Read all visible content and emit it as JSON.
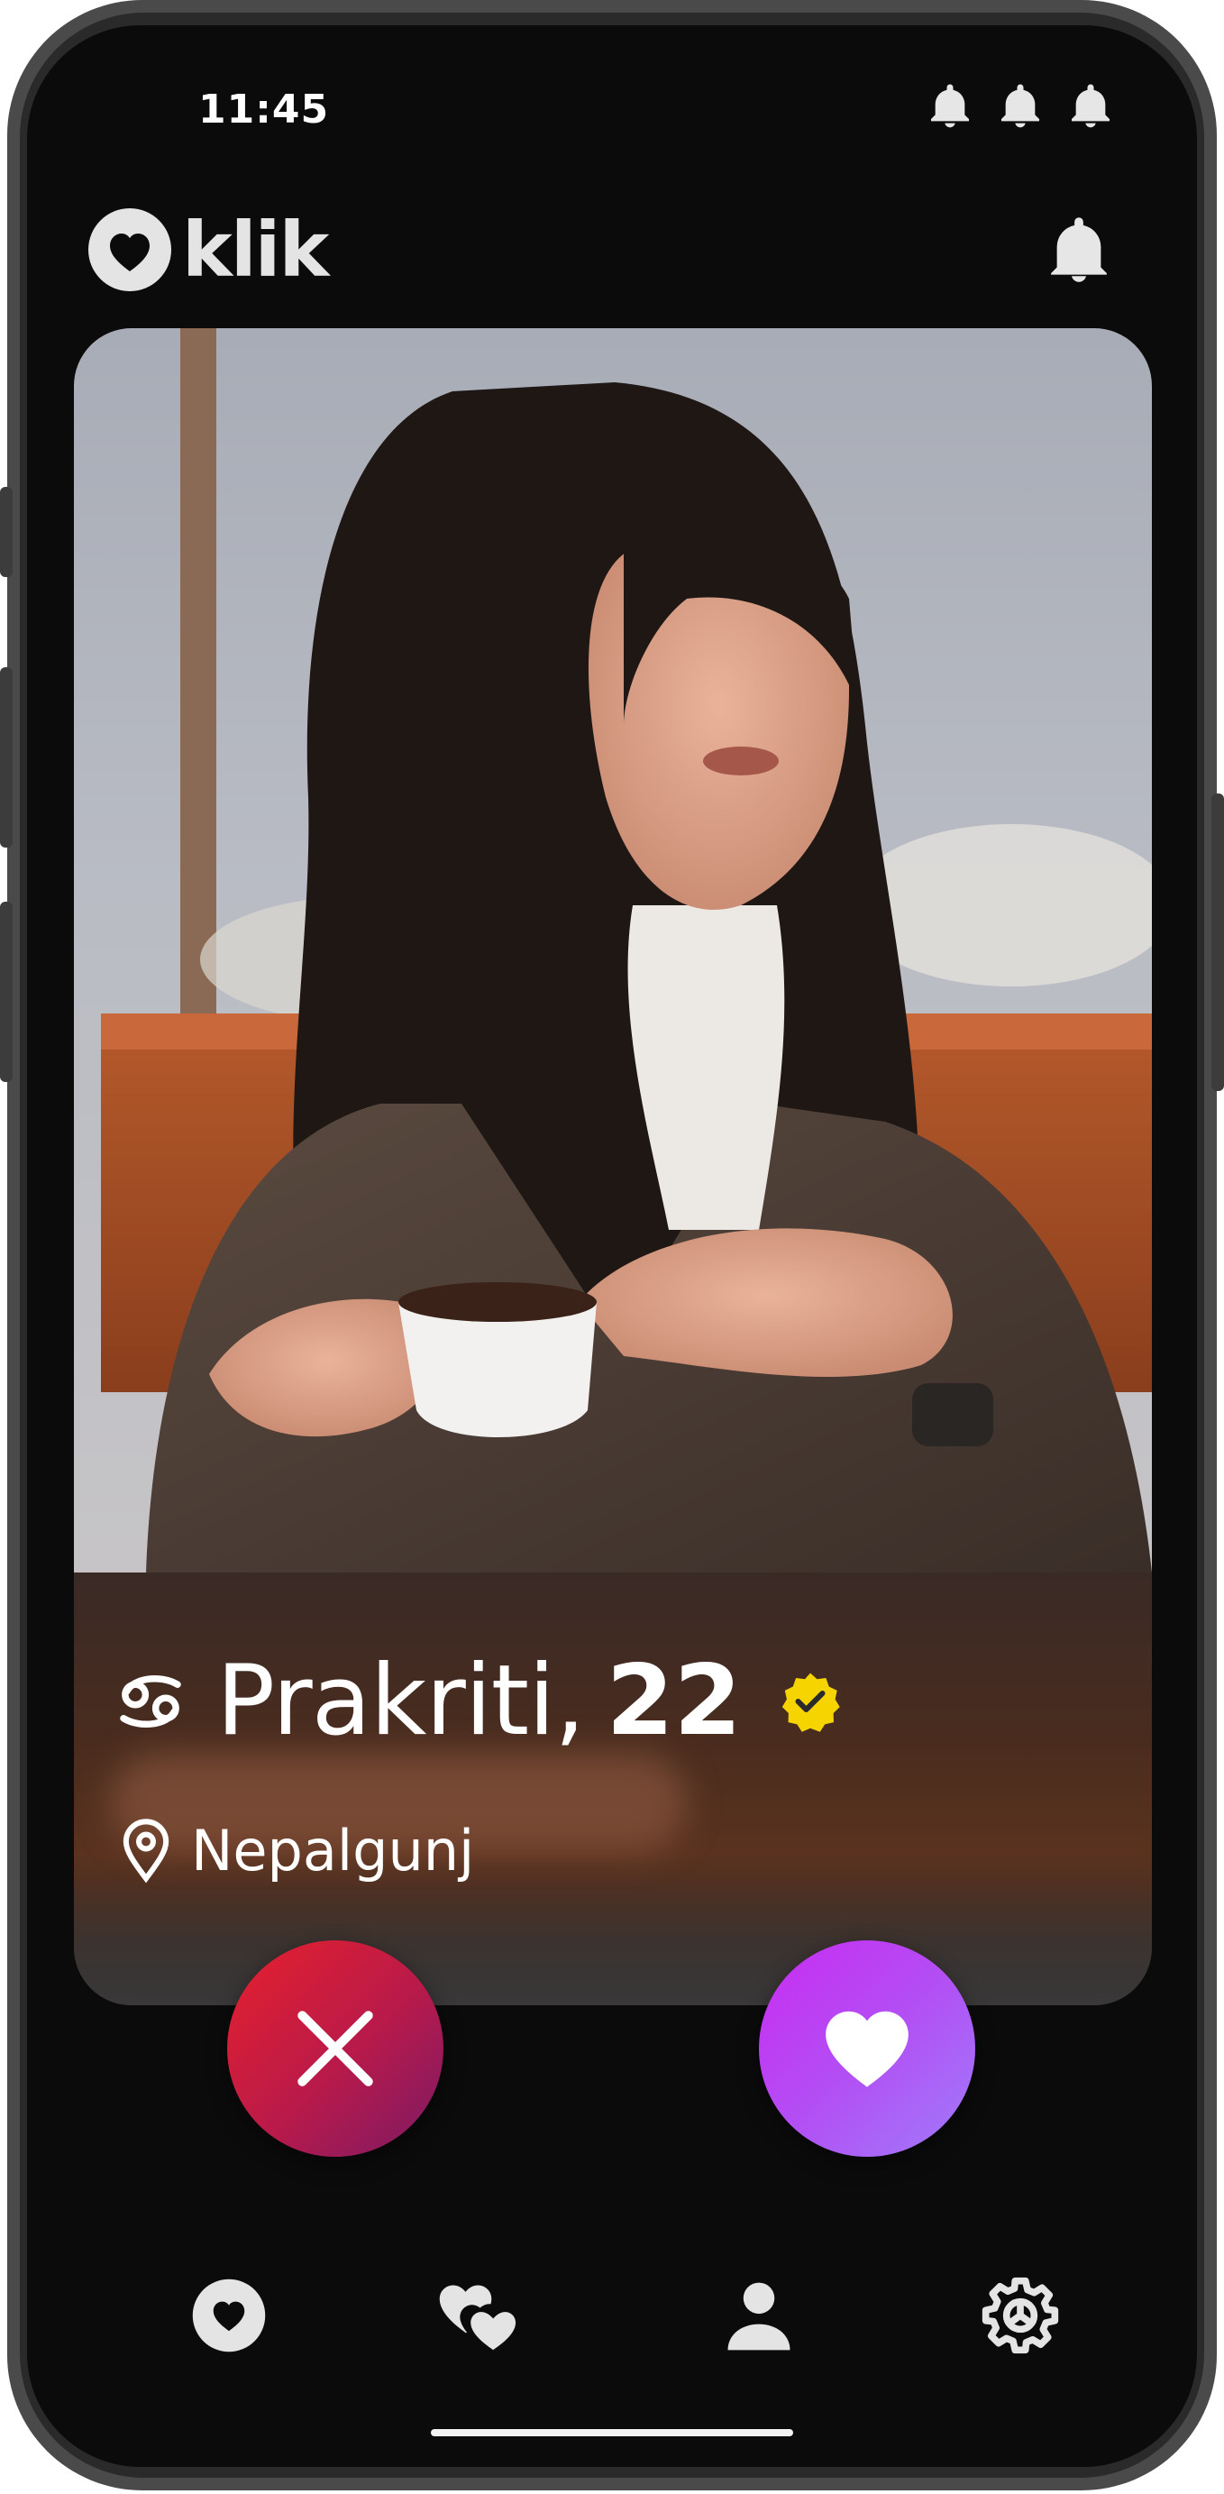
{
  "status_bar": {
    "time": "11:45",
    "icons": [
      "bell-icon",
      "bell-icon",
      "bell-icon"
    ]
  },
  "header": {
    "logo_text": "klik",
    "logo_icon": "heart-circle-icon",
    "notification_icon": "bell-icon"
  },
  "profile": {
    "photo_description": "woman holding coffee cup",
    "zodiac_icon": "cancer-zodiac-icon",
    "name": "Prakriti,",
    "age": "22",
    "verified_icon": "verified-badge-icon",
    "verified_color": "#f5d400",
    "location_icon": "map-pin-icon",
    "location": "Nepalgunj"
  },
  "actions": {
    "reject_icon": "close-icon",
    "reject_colors": [
      "#e8202c",
      "#7a1a66"
    ],
    "like_icon": "heart-icon",
    "like_colors": [
      "#c92cf2",
      "#a07cfa"
    ]
  },
  "bottom_nav": {
    "items": [
      {
        "id": "discover",
        "icon": "heart-circle-icon"
      },
      {
        "id": "matches",
        "icon": "two-hearts-icon"
      },
      {
        "id": "profile",
        "icon": "person-icon"
      },
      {
        "id": "settings",
        "icon": "gear-icon"
      }
    ]
  }
}
